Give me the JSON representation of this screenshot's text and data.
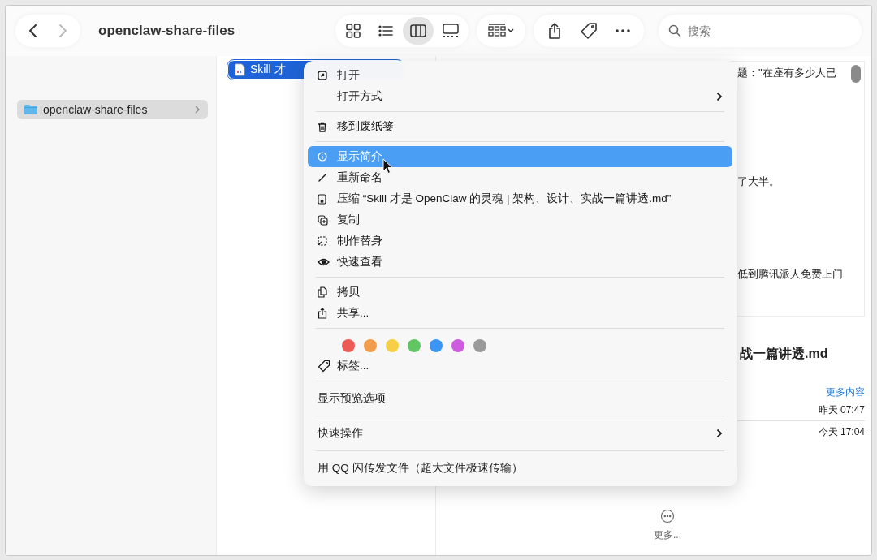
{
  "window": {
    "title": "openclaw-share-files"
  },
  "navigation": [
    {
      "kind": "back",
      "disabled": false
    },
    {
      "kind": "forward",
      "disabled": true
    }
  ],
  "view_modes": [
    {
      "kind": "icons",
      "selected": false
    },
    {
      "kind": "list",
      "selected": false
    },
    {
      "kind": "columns",
      "selected": true
    },
    {
      "kind": "gallery",
      "selected": false
    }
  ],
  "search": {
    "placeholder": "搜索"
  },
  "sidebar": {
    "items": [
      {
        "label": "openclaw-share-files",
        "selected": true
      }
    ]
  },
  "file_column": {
    "items": [
      {
        "name": "Skill 才",
        "selected": true
      }
    ]
  },
  "preview": {
    "snippets": [
      "题：\"在座有多少人已",
      "了大半。",
      "低到腾讯派人免费上门"
    ],
    "title": "战一篇讲透.md",
    "more_link": "更多内容",
    "dates": [
      "昨天 07:47",
      "今天 17:04"
    ],
    "more_button": "更多..."
  },
  "context_menu": {
    "groups": [
      {
        "kind": "items",
        "items": [
          {
            "label": "打开",
            "selected": false,
            "submenu": false
          },
          {
            "label": "打开方式",
            "selected": false,
            "submenu": true
          }
        ]
      },
      {
        "kind": "items",
        "items": [
          {
            "label": "移到废纸篓",
            "selected": false,
            "submenu": false
          }
        ]
      },
      {
        "kind": "items",
        "items": [
          {
            "label": "显示简介",
            "selected": true,
            "submenu": false
          },
          {
            "label": "重新命名",
            "selected": false,
            "submenu": false
          },
          {
            "label": "压缩 “Skill 才是 OpenClaw 的灵魂 | 架构、设计、实战一篇讲透.md”",
            "selected": false,
            "submenu": false
          },
          {
            "label": "复制",
            "selected": false,
            "submenu": false
          },
          {
            "label": "制作替身",
            "selected": false,
            "submenu": false
          },
          {
            "label": "快速查看",
            "selected": false,
            "submenu": false
          }
        ]
      },
      {
        "kind": "items",
        "items": [
          {
            "label": "拷贝",
            "selected": false,
            "submenu": false
          },
          {
            "label": "共享...",
            "selected": false,
            "submenu": false
          }
        ]
      },
      {
        "kind": "tags",
        "tags": [
          {
            "color": "#ec5b56"
          },
          {
            "color": "#f29d4b"
          },
          {
            "color": "#f7cf45"
          },
          {
            "color": "#5fc662"
          },
          {
            "color": "#3b95f4"
          },
          {
            "color": "#cd5ce0"
          },
          {
            "color": "#9a9a9a"
          }
        ],
        "items": [
          {
            "label": "标签...",
            "selected": false,
            "submenu": false
          }
        ]
      },
      {
        "kind": "plain",
        "items": [
          {
            "label": "显示预览选项",
            "selected": false,
            "submenu": false
          }
        ]
      },
      {
        "kind": "plain",
        "items": [
          {
            "label": "快速操作",
            "selected": false,
            "submenu": true
          }
        ]
      },
      {
        "kind": "plain",
        "items": [
          {
            "label": "用 QQ 闪传发文件（超大文件极速传输）",
            "selected": false,
            "submenu": false
          }
        ]
      }
    ]
  }
}
